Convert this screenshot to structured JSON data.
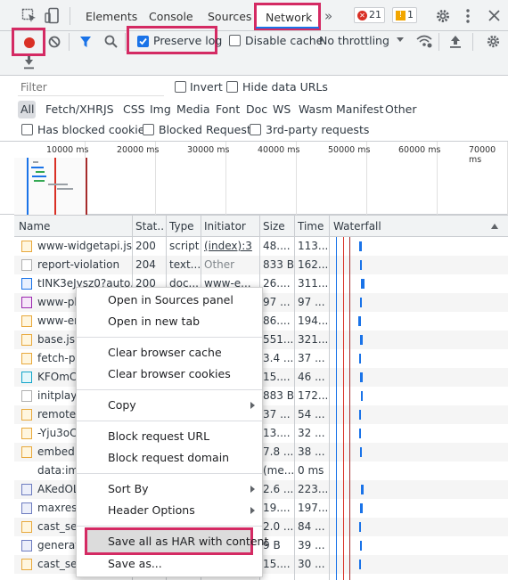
{
  "tabs": {
    "elements": "Elements",
    "console": "Console",
    "sources": "Sources",
    "network": "Network",
    "more": "»",
    "errors_count": "21",
    "warnings_count": "1"
  },
  "toolbar": {
    "preserve_log": "Preserve log",
    "disable_cache": "Disable cache",
    "throttling": "No throttling"
  },
  "filter": {
    "placeholder": "Filter",
    "invert": "Invert",
    "hide_data_urls": "Hide data URLs",
    "types": [
      "All",
      "Fetch/XHR",
      "JS",
      "CSS",
      "Img",
      "Media",
      "Font",
      "Doc",
      "WS",
      "Wasm",
      "Manifest",
      "Other"
    ],
    "has_blocked_cookies": "Has blocked cookies",
    "blocked_requests": "Blocked Requests",
    "third_party": "3rd-party requests"
  },
  "overview": {
    "ticks": [
      "10000 ms",
      "20000 ms",
      "30000 ms",
      "40000 ms",
      "50000 ms",
      "60000 ms",
      "70000 ms"
    ]
  },
  "table": {
    "headers": {
      "name": "Name",
      "status": "Stat..",
      "type": "Type",
      "initiator": "Initiator",
      "size": "Size",
      "time": "Time",
      "waterfall": "Waterfall"
    },
    "rows": [
      {
        "name": "www-widgetapi.js",
        "status": "200",
        "type": "script",
        "initiator": "(index):3",
        "size": "48....",
        "time": "113...",
        "icon": "js"
      },
      {
        "name": "report-violation",
        "status": "204",
        "type": "text...",
        "initiator": "Other",
        "size": "833 B",
        "time": "162...",
        "icon": "plain"
      },
      {
        "name": "tINK3eJysz0?auto...",
        "status": "200",
        "type": "doc...",
        "initiator": "www-e...",
        "size": "26....",
        "time": "311...",
        "icon": "doc"
      },
      {
        "name": "www-pl",
        "status": "",
        "type": "",
        "initiator": "",
        "size": "97 ...",
        "time": "97 ...",
        "icon": "gear"
      },
      {
        "name": "www-en",
        "status": "",
        "type": "",
        "initiator": "",
        "size": "86....",
        "time": "194...",
        "icon": "js"
      },
      {
        "name": "base.js",
        "status": "",
        "type": "",
        "initiator": "",
        "size": "551...",
        "time": "321...",
        "icon": "js"
      },
      {
        "name": "fetch-po",
        "status": "",
        "type": "",
        "initiator": "",
        "size": "3.4 ...",
        "time": "37 ...",
        "icon": "js"
      },
      {
        "name": "KFOmCn",
        "status": "",
        "type": "",
        "initiator": "",
        "size": "15....",
        "time": "46 ...",
        "icon": "font"
      },
      {
        "name": "initplayb",
        "status": "",
        "type": "",
        "initiator": "",
        "size": "883 B",
        "time": "172...",
        "icon": "plain"
      },
      {
        "name": "remote.j",
        "status": "",
        "type": "",
        "initiator": "",
        "size": "37 ...",
        "time": "54 ...",
        "icon": "js"
      },
      {
        "name": "-Yju3oC",
        "status": "",
        "type": "",
        "initiator": "",
        "size": "13....",
        "time": "32 ...",
        "icon": "js"
      },
      {
        "name": "embed.js",
        "status": "",
        "type": "",
        "initiator": "",
        "size": "7.8 ...",
        "time": "38 ...",
        "icon": "js"
      },
      {
        "name": "data:ima",
        "status": "",
        "type": "",
        "initiator": "",
        "size": "(me...",
        "time": "0 ms",
        "icon": "none"
      },
      {
        "name": "AKedOL",
        "status": "",
        "type": "",
        "initiator": "",
        "size": "2.6 ...",
        "time": "223...",
        "icon": "img"
      },
      {
        "name": "maxresd",
        "status": "",
        "type": "",
        "initiator": "",
        "size": "19....",
        "time": "197...",
        "icon": "img"
      },
      {
        "name": "cast_sen",
        "status": "",
        "type": "",
        "initiator": "",
        "size": "2.0 ...",
        "time": "84 ...",
        "icon": "js"
      },
      {
        "name": "generate",
        "status": "",
        "type": "",
        "initiator": "",
        "size": "9 B",
        "time": "39 ...",
        "icon": "img"
      },
      {
        "name": "cast_sen",
        "status": "",
        "type": "",
        "initiator": "",
        "size": "15....",
        "time": "30 ...",
        "icon": "js"
      }
    ]
  },
  "context_menu": {
    "open_in_sources": "Open in Sources panel",
    "open_in_new_tab": "Open in new tab",
    "clear_browser_cache": "Clear browser cache",
    "clear_browser_cookies": "Clear browser cookies",
    "copy": "Copy",
    "block_request_url": "Block request URL",
    "block_request_domain": "Block request domain",
    "sort_by": "Sort By",
    "header_options": "Header Options",
    "save_all_as_har": "Save all as HAR with content",
    "save_as": "Save as..."
  },
  "colors": {
    "highlight": "#d42a63",
    "record": "#d93025",
    "accent": "#1a73e8"
  }
}
